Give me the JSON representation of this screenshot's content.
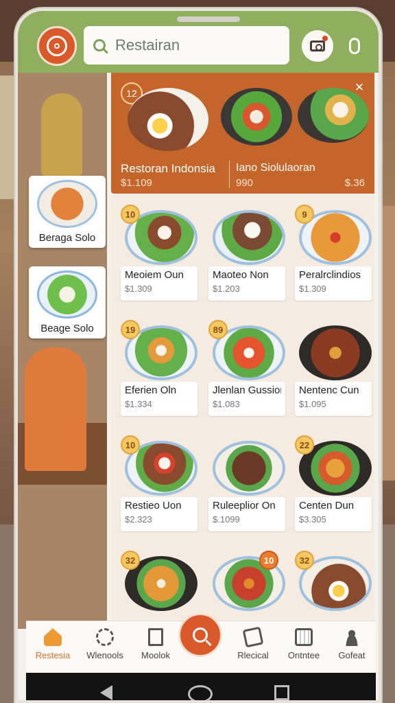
{
  "search": {
    "value": "Restairan"
  },
  "side_cards": [
    {
      "label": "Beraga Solo"
    },
    {
      "label": "Beage Solo"
    }
  ],
  "featured": {
    "badge": "12",
    "close": "×",
    "title_left": "Restoran Indonsia",
    "price_left": "$1.109",
    "title_right": "Iano Siolulaoran",
    "price_right": "990",
    "price_far": "$.36"
  },
  "menu_items": [
    {
      "badge": "10",
      "name": "Meoiem Oun",
      "price": "$1.309"
    },
    {
      "badge": "",
      "name": "Maoteo Non",
      "price": "$1.203"
    },
    {
      "badge": "9",
      "name": "Peralrclindios",
      "price": "$1.309"
    },
    {
      "badge": "19",
      "name": "Eferien Oln",
      "price": "$1.334"
    },
    {
      "badge": "89",
      "name": "Jlenlan Gussions",
      "price": "$1.083"
    },
    {
      "badge": "",
      "name": "Nentenc Cun",
      "price": "$1.095"
    },
    {
      "badge": "10",
      "name": "Restieo Uon",
      "price": "$2.323"
    },
    {
      "badge": "",
      "name": "Ruleeplior On",
      "price": "$.1099"
    },
    {
      "badge": "22",
      "name": "Centen Dun",
      "price": "$3.305"
    },
    {
      "badge": "32",
      "name": "",
      "price": ""
    },
    {
      "badge": "10",
      "name": "",
      "price": ""
    },
    {
      "badge": "32",
      "name": "",
      "price": ""
    }
  ],
  "nav": [
    {
      "label": "Restesia",
      "icon": "home-icon"
    },
    {
      "label": "Wlenools",
      "icon": "gear-icon"
    },
    {
      "label": "Moolok",
      "icon": "document-icon"
    },
    {
      "label": "Rlecical",
      "icon": "pen-icon"
    },
    {
      "label": "Ontntee",
      "icon": "calendar-icon"
    },
    {
      "label": "Gofeat",
      "icon": "user-icon"
    }
  ],
  "colors": {
    "accent": "#d9592a",
    "top_bar": "#8fae5e",
    "featured_bg": "#c4662b",
    "active_nav": "#d6702a"
  }
}
